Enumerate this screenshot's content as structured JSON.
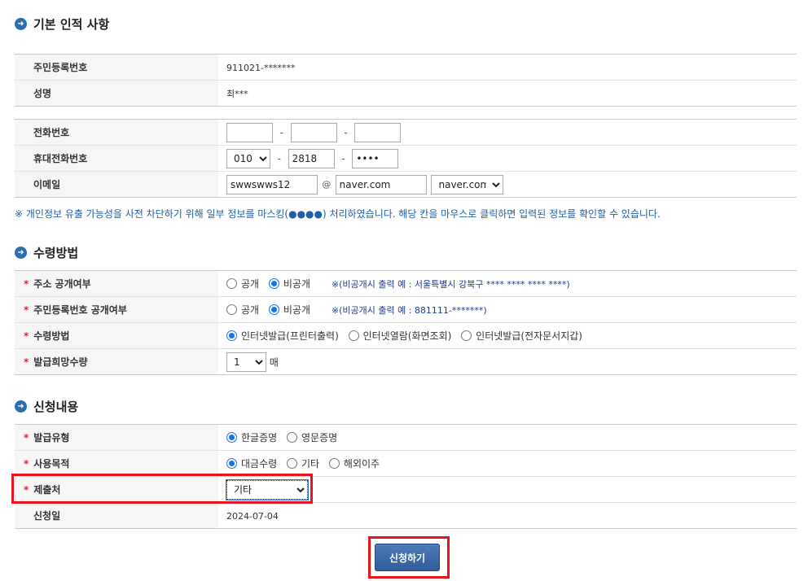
{
  "sections": {
    "basic": "기본 인적 사항",
    "receive": "수령방법",
    "request": "신청내용"
  },
  "basic": {
    "rrn_label": "주민등록번호",
    "rrn_value": "911021-*******",
    "name_label": "성명",
    "name_value": "최***"
  },
  "contact": {
    "phone_label": "전화번호",
    "phone": [
      "",
      "",
      ""
    ],
    "mobile_label": "휴대전화번호",
    "mobile_prefix": "010",
    "mobile_mid": "2818",
    "mobile_last": "••••",
    "email_label": "이메일",
    "email_id": "swwswws12",
    "at": "@",
    "email_domain": "naver.com",
    "email_domain_select": "naver.com"
  },
  "notice": "※ 개인정보 유출 가능성을 사전 차단하기 위해 일부 정보를 마스킹(●●●●) 처리하였습니다. 해당 칸을 마우스로 클릭하면 입력된 정보를 확인할 수 있습니다.",
  "receive": {
    "addr_label": "주소 공개여부",
    "addr_opt_public": "공개",
    "addr_opt_private": "비공개",
    "addr_note": "※(비공개시 출력 예 : 서울특별시 강북구 **** **** **** ****)",
    "rrn_label": "주민등록번호 공개여부",
    "rrn_opt_public": "공개",
    "rrn_opt_private": "비공개",
    "rrn_note": "※(비공개시 출력 예 : 881111-*******)",
    "method_label": "수령방법",
    "method_opts": [
      "인터넷발급(프린터출력)",
      "인터넷열람(화면조회)",
      "인터넷발급(전자문서지갑)"
    ],
    "qty_label": "발급희망수량",
    "qty_value": "1",
    "qty_unit": "매"
  },
  "request": {
    "type_label": "발급유형",
    "type_opts": [
      "한글증명",
      "영문증명"
    ],
    "purpose_label": "사용목적",
    "purpose_opts": [
      "대금수령",
      "기타",
      "해외이주"
    ],
    "submit_to_label": "제출처",
    "submit_to_value": "기타",
    "date_label": "신청일",
    "date_value": "2024-07-04"
  },
  "submit_label": "신청하기",
  "required_mark": "*"
}
